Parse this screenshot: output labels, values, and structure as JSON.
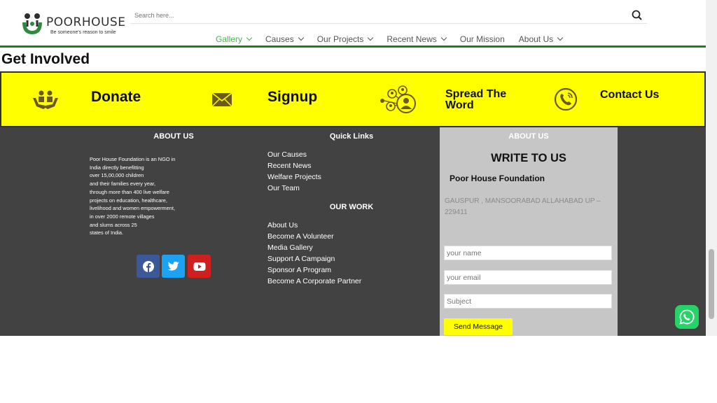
{
  "header": {
    "logo_name": "POORHOUSE",
    "logo_tagline": "Be someone's reason to smile",
    "search_placeholder": "Search here..."
  },
  "nav": {
    "items": [
      {
        "label": "Gallery",
        "dropdown": true,
        "active": true
      },
      {
        "label": "Causes",
        "dropdown": true
      },
      {
        "label": "Our Projects",
        "dropdown": true
      },
      {
        "label": "Recent News",
        "dropdown": true
      },
      {
        "label": "Our Mission",
        "dropdown": false
      },
      {
        "label": "About Us",
        "dropdown": true
      }
    ]
  },
  "page_title": "Get Involved",
  "actions": {
    "donate": "Donate",
    "signup": "Signup",
    "spread_line1": "Spread The",
    "spread_line2": "Word",
    "contact": "Contact Us"
  },
  "footer": {
    "about_heading": "ABOUT US",
    "about_lines": [
      "Poor House Foundation is an NGO in",
      "India directly benefitting",
      "over 15,00,000 children",
      "and their families every year,",
      "through more than 400 live welfare",
      "projects on education, healthcare,",
      "livelihood and women empowerment,",
      "in over 2000 remote villages",
      "and slums across 25",
      "states of India."
    ],
    "quick_links_heading": "Quick Links",
    "quick_links": [
      "Our Causes",
      "Recent News",
      "Welfare Projects",
      "Our Team"
    ],
    "our_work_heading": "OUR WORK",
    "our_work": [
      "About Us",
      "Become A Volunteer",
      "Media Gallery",
      "Support A Campaign",
      "Sponsor A Program",
      "Become A Corporate Partner"
    ]
  },
  "contact_form": {
    "heading": "ABOUT US",
    "title": "WRITE TO US",
    "org": "Poor House Foundation",
    "address": "GAUSPUR , MANSOORABAD ALLAHABAD UP – 229411",
    "name_placeholder": "your name",
    "email_placeholder": "your email",
    "subject_placeholder": "Subject",
    "send_label": "Send Message"
  },
  "colors": {
    "accent_green": "#4caf50",
    "band_yellow": "#ffff00",
    "footer_bg": "#424242",
    "facebook": "#3b5998",
    "twitter": "#1da1f2",
    "youtube": "#cd201f",
    "whatsapp": "#25d366"
  },
  "icons": [
    "search-icon",
    "hands-heart-icon",
    "envelope-icon",
    "people-network-icon",
    "phone-icon",
    "facebook-icon",
    "twitter-icon",
    "youtube-icon",
    "whatsapp-icon",
    "chevron-down-icon"
  ]
}
